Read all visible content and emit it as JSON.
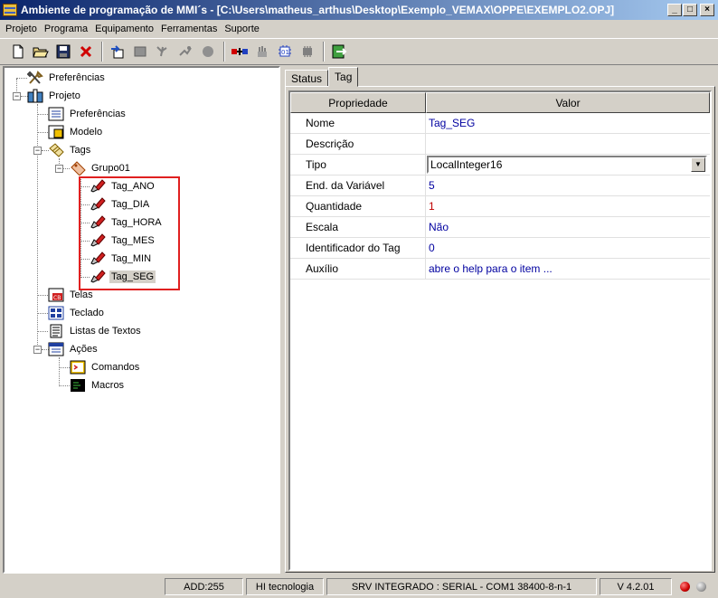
{
  "window": {
    "title": "Ambiente de programação de MMI´s - [C:\\Users\\matheus_arthus\\Desktop\\Exemplo_VEMAX\\OPPE\\EXEMPLO2.OPJ]",
    "minimize": "_",
    "maximize": "□",
    "close": "×"
  },
  "menu": [
    "Projeto",
    "Programa",
    "Equipamento",
    "Ferramentas",
    "Suporte"
  ],
  "toolbar_icons": [
    "new-file-icon",
    "open-folder-icon",
    "save-disk-icon",
    "delete-x-icon",
    "export-icon",
    "stop-icon",
    "compile-icon",
    "link-icon",
    "record-icon",
    "download-icon",
    "hand-icon",
    "chip-icon",
    "device-icon",
    "exit-icon"
  ],
  "tree": {
    "preferencias_root": "Preferências",
    "projeto": "Projeto",
    "preferencias": "Preferências",
    "modelo": "Modelo",
    "tags": "Tags",
    "grupo": "Grupo01",
    "tag_items": [
      "Tag_ANO",
      "Tag_DIA",
      "Tag_HORA",
      "Tag_MES",
      "Tag_MIN",
      "Tag_SEG"
    ],
    "telas": "Telas",
    "teclado": "Teclado",
    "listas": "Listas de Textos",
    "acoes": "Ações",
    "comandos": "Comandos",
    "macros": "Macros"
  },
  "tabs": [
    "Status",
    "Tag"
  ],
  "grid": {
    "header_prop": "Propriedade",
    "header_val": "Valor",
    "rows": [
      {
        "prop": "Nome",
        "val": "Tag_SEG"
      },
      {
        "prop": "Descrição",
        "val": ""
      },
      {
        "prop": "Tipo",
        "val": "LocalInteger16"
      },
      {
        "prop": "End. da Variável",
        "val": "5"
      },
      {
        "prop": "Quantidade",
        "val": "1"
      },
      {
        "prop": "Escala",
        "val": "Não"
      },
      {
        "prop": "Identificador do Tag",
        "val": "0"
      },
      {
        "prop": "Auxílio",
        "val": "abre o help para o item ..."
      }
    ],
    "combo_arrow": "▼"
  },
  "status": {
    "add": "ADD:255",
    "company": "HI tecnologia",
    "server": "SRV INTEGRADO : SERIAL - COM1 38400-8-n-1",
    "version": "V 4.2.01"
  },
  "colors": {
    "row_value": "#0000a0",
    "quantidade": "#c00000",
    "highlight": "#e02020",
    "led_red": "#cc0000",
    "led_gray": "#a0a0a0"
  }
}
